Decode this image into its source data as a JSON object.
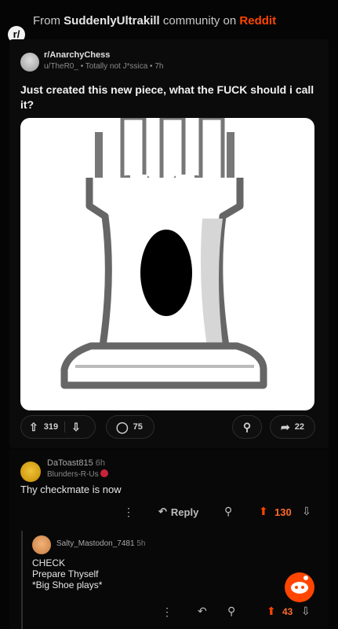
{
  "header": {
    "prefix": "From ",
    "community": "SuddenlyUltrakill",
    "middle": " community on ",
    "platform": "Reddit",
    "logo_text": "r/"
  },
  "post": {
    "subreddit": "r/AnarchyChess",
    "author_meta": "u/TheR0_ • Totally not J*ssica • 7h",
    "title": "Just created this new piece, what the FUCK should i call it?",
    "upvotes": "319",
    "comments": "75",
    "shares": "22"
  },
  "comments": [
    {
      "user": "DaToast815",
      "age": "6h",
      "flair": "Blunders-R-Us",
      "text": "Thy checkmate is now",
      "reply_label": "Reply",
      "score": "130"
    },
    {
      "user": "Salty_Mastodon_7481",
      "age": "5h",
      "lines": [
        "CHECK",
        "Prepare Thyself",
        "*Big Shoe plays*"
      ],
      "score": "43"
    }
  ],
  "colors": {
    "accent": "#ff4500",
    "background": "#050505"
  },
  "icons": {
    "upvote": "arrow-up-icon",
    "downvote": "arrow-down-icon",
    "comment": "comment-bubble-icon",
    "award": "award-icon",
    "share": "share-icon",
    "reply": "reply-arrow-icon",
    "more": "more-vertical-icon"
  }
}
